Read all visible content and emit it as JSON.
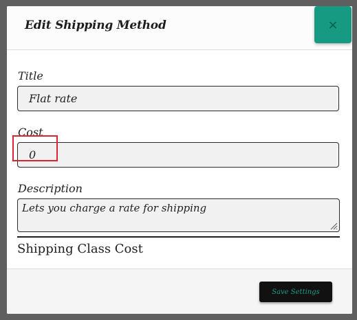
{
  "modal": {
    "title": "Edit Shipping Method",
    "close_label": "×"
  },
  "fields": {
    "title_label": "Title",
    "title_value": "Flat rate",
    "cost_label": "Cost",
    "cost_value": "0",
    "description_label": "Description",
    "description_value": "Lets you charge a rate for shipping"
  },
  "section": {
    "heading": "Shipping Class Cost"
  },
  "footer": {
    "save_label": "Save Settings"
  },
  "colors": {
    "accent": "#169a82",
    "highlight": "#d9262c",
    "save_button_bg": "#111111",
    "save_button_text": "#1f9d86"
  },
  "icons": {
    "close": "close-icon",
    "resize": "resize-grip-icon"
  }
}
